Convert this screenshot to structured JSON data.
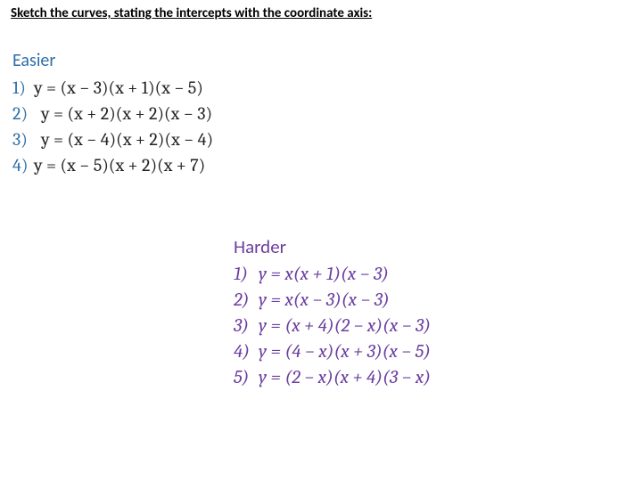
{
  "instruction": "Sketch the curves, stating the intercepts with the coordinate axis:",
  "easier": {
    "title": "Easier",
    "items": [
      {
        "idx": "1)",
        "eq": "y = (x − 3)(x + 1)(x − 5)",
        "lead": true
      },
      {
        "idx": "2)",
        "eq": "y = (x + 2)(x + 2)(x − 3)",
        "lead": false
      },
      {
        "idx": "3)",
        "eq": "y = (x − 4)(x + 2)(x − 4)",
        "lead": false
      },
      {
        "idx": "4)",
        "eq": "y = (x − 5)(x + 2)(x + 7)",
        "lead": true
      }
    ]
  },
  "harder": {
    "title": "Harder",
    "items": [
      {
        "idx": "1)",
        "eq": "y = x(x + 1)(x − 3)"
      },
      {
        "idx": "2)",
        "eq": "y = x(x − 3)(x − 3)"
      },
      {
        "idx": "3)",
        "eq": "y = (x + 4)(2 − x)(x − 3)"
      },
      {
        "idx": "4)",
        "eq": "y = (4 − x)(x + 3)(x − 5)"
      },
      {
        "idx": "5)",
        "eq": "y = (2 − x)(x + 4)(3 − x)"
      }
    ]
  }
}
